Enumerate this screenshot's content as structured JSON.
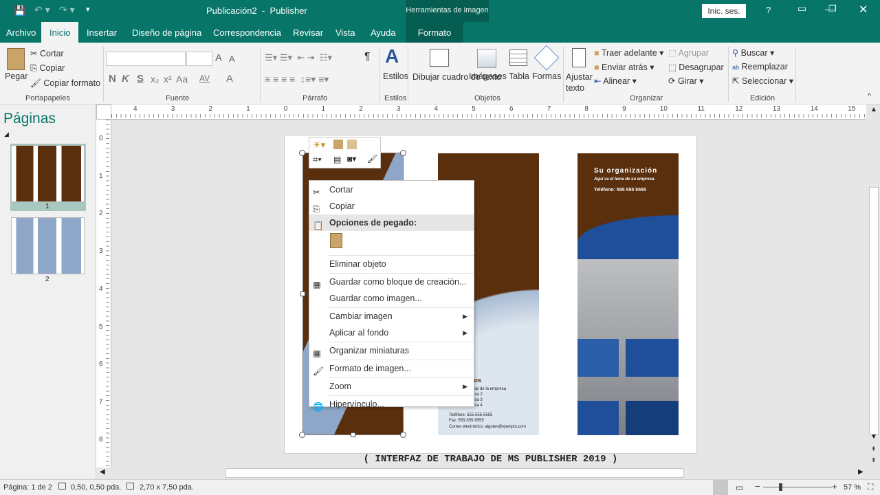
{
  "title": {
    "doc": "Publicación2",
    "sep": "-",
    "app": "Publisher",
    "tool_context": "Herramientas de imagen",
    "signin": "Inic. ses.",
    "help": "?"
  },
  "tabs": [
    "Archivo",
    "Inicio",
    "Insertar",
    "Diseño de página",
    "Correspondencia",
    "Revisar",
    "Vista",
    "Ayuda",
    "Formato"
  ],
  "ribbon": {
    "clipboard": {
      "paste": "Pegar",
      "cut": "Cortar",
      "copy": "Copiar",
      "format_painter": "Copiar formato",
      "group": "Portapapeles"
    },
    "font": {
      "group": "Fuente",
      "bold": "N",
      "italic": "K",
      "strike": "S",
      "sub": "x₂",
      "sup": "x²",
      "case": "Aa",
      "spacing": "AV",
      "color": "A",
      "grow": "A",
      "shrink": "A"
    },
    "paragraph": {
      "group": "Párrafo",
      "pilcrow": "¶"
    },
    "styles": {
      "label": "Estilos",
      "group": "Estilos"
    },
    "objects": {
      "textbox": "Dibujar cuadro de texto",
      "images": "Imágenes",
      "table": "Tabla",
      "shapes": "Formas",
      "group": "Objetos"
    },
    "arrange": {
      "wrap": "Ajustar texto",
      "bring_forward": "Traer adelante",
      "send_back": "Enviar atrás",
      "align": "Alinear",
      "group_btn": "Agrupar",
      "ungroup": "Desagrupar",
      "rotate": "Girar",
      "group": "Organizar"
    },
    "editing": {
      "find": "Buscar",
      "replace": "Reemplazar",
      "select": "Seleccionar",
      "group": "Edición"
    }
  },
  "pages_panel": {
    "title": "Páginas",
    "pages": [
      "1",
      "2"
    ]
  },
  "ruler": {
    "h": [
      "4",
      "3",
      "2",
      "1",
      "0",
      "1",
      "2",
      "3",
      "4",
      "5",
      "6",
      "7",
      "8",
      "9",
      "10",
      "11",
      "12",
      "13",
      "14",
      "15"
    ],
    "v": [
      "0",
      "1",
      "2",
      "3",
      "4",
      "5",
      "6",
      "7",
      "8"
    ]
  },
  "brochure": {
    "org": "Su organización",
    "tagline": "Aquí va el lema de su empresa.",
    "phone": "Teléfono: 555 555 5555",
    "contact_title": "ios",
    "address": [
      "ipal de la empresa",
      "esa 2",
      "esa 3",
      "esa 4"
    ],
    "tel": "Teléfono: 555-555-5555",
    "fax": "Fax: 555-555-5555",
    "email": "Correo electrónico: alguien@ejemplo.com"
  },
  "context_menu": [
    {
      "label": "Cortar",
      "icon": "scissors-icon"
    },
    {
      "label": "Copiar",
      "icon": "copy-icon"
    },
    {
      "label": "Opciones de pegado:",
      "icon": "paste-icon",
      "header": true
    },
    {
      "label": "Eliminar objeto"
    },
    {
      "label": "Guardar como bloque de creación...",
      "icon": "building-block-icon"
    },
    {
      "label": "Guardar como imagen..."
    },
    {
      "label": "Cambiar imagen",
      "submenu": true
    },
    {
      "label": "Aplicar al fondo",
      "submenu": true
    },
    {
      "label": "Organizar miniaturas",
      "icon": "thumbnails-icon"
    },
    {
      "label": "Formato de imagen...",
      "icon": "format-picture-icon"
    },
    {
      "label": "Zoom",
      "submenu": true
    },
    {
      "label": "Hipervínculo...",
      "icon": "hyperlink-icon"
    }
  ],
  "caption": "( INTERFAZ DE TRABAJO DE MS PUBLISHER 2019 )",
  "status": {
    "page": "Página: 1 de 2",
    "position": "0,50, 0,50 pda.",
    "size": "2,70 x  7,50 pda.",
    "zoom": "57 %",
    "zoom_percent": 57
  },
  "colors": {
    "brand": "#077568",
    "brown": "#5a2f0e"
  }
}
